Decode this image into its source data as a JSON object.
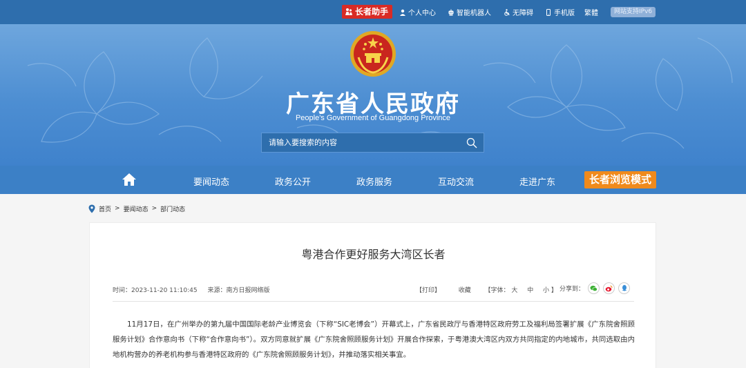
{
  "topbar": {
    "elder_helper": "长者助手",
    "personal_center": "个人中心",
    "smart_robot": "智能机器人",
    "accessibility": "无障碍",
    "mobile": "手机版",
    "traditional": "繁體",
    "ipv6": "网站支持IPv6"
  },
  "header": {
    "title": "广东省人民政府",
    "subtitle": "People's Government of Guangdong Province"
  },
  "search": {
    "placeholder": "请输入要搜索的内容"
  },
  "nav": {
    "items": [
      "要闻动态",
      "政务公开",
      "政务服务",
      "互动交流",
      "走进广东"
    ],
    "elder_mode": "长者浏览模式"
  },
  "breadcrumb": {
    "home": "首页",
    "sep": ">",
    "level1": "要闻动态",
    "level2": "部门动态"
  },
  "article": {
    "title": "粤港合作更好服务大湾区长者",
    "time": "时间：2023-11-20 11:10:45",
    "source": "来源：南方日报网络版",
    "print": "【打印】",
    "favorite": "收藏",
    "font_label": "【字体：",
    "font_large": "大",
    "font_medium": "中",
    "font_small": "小",
    "font_end": "】",
    "share_label": "分享到：",
    "paragraph": "11月17日，在广州举办的第九届中国国际老龄产业博览会（下称“SIC老博会”）开幕式上，广东省民政厅与香港特区政府劳工及福利局签署扩展《广东院舍照顾服务计划》合作意向书（下称“合作意向书”）。双方同意就扩展《广东院舍照顾服务计划》开展合作探索，于粤港澳大湾区内双方共同指定的内地城市，共同选取由内地机构营办的养老机构参与香港特区政府的《广东院舍照顾服务计划》，并推动落实相关事宜。"
  },
  "colors": {
    "topbar": "#2e6ead",
    "nav": "#3c80c6",
    "elder_helper": "#d92b25",
    "elder_mode": "#f08a1c"
  }
}
